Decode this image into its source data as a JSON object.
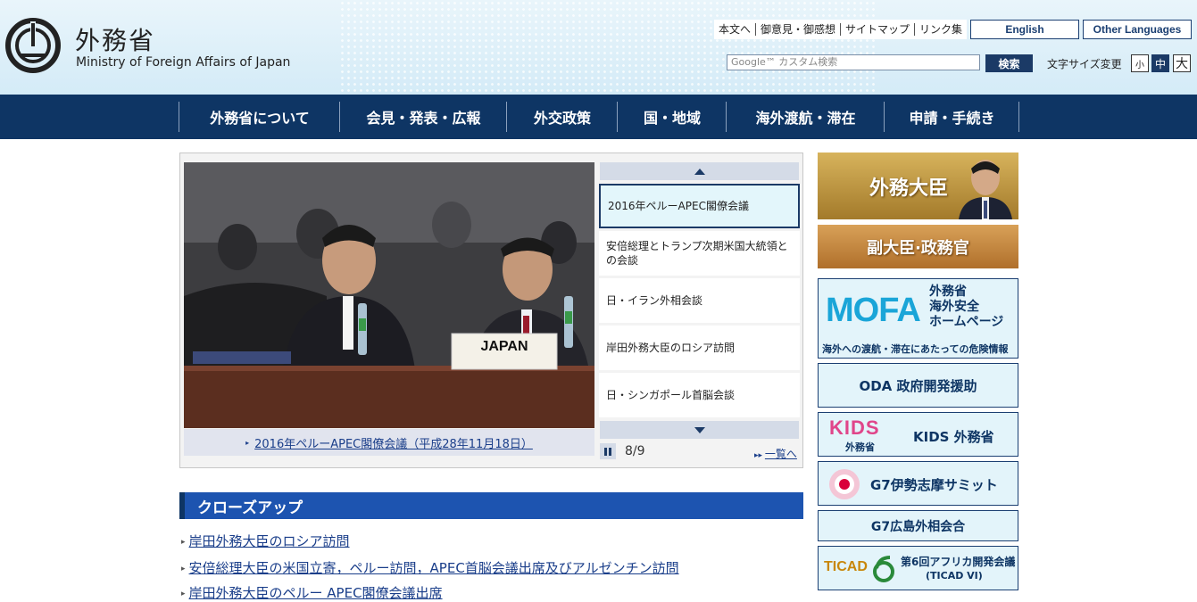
{
  "header": {
    "site_title_ja": "外務省",
    "site_title_en": "Ministry of Foreign Affairs of Japan",
    "util_links": [
      "本文へ",
      "御意見・御感想",
      "サイトマップ",
      "リンク集"
    ],
    "english_label": "English",
    "other_languages_label": "Other Languages",
    "search_placeholder": "Google™ カスタム検索",
    "search_button": "検索",
    "font_size_label": "文字サイズ変更",
    "font_sizes": [
      "小",
      "中",
      "大"
    ]
  },
  "nav": {
    "items": [
      "外務省について",
      "会見・発表・広報",
      "外交政策",
      "国・地域",
      "海外渡航・滞在",
      "申請・手続き"
    ]
  },
  "slider": {
    "photo_sign": "JAPAN",
    "caption": "2016年ペルーAPEC閣僚会議（平成28年11月18日）",
    "items": [
      "2016年ペルーAPEC閣僚会議",
      "安倍総理とトランプ次期米国大統領との会談",
      "日・イラン外相会談",
      "岸田外務大臣のロシア訪問",
      "日・シンガポール首脳会談"
    ],
    "counter": "8/9",
    "list_link": "一覧へ"
  },
  "closeup": {
    "heading": "クローズアップ",
    "items": [
      "岸田外務大臣のロシア訪問",
      "安倍総理大臣の米国立寄，ペルー訪問，APEC首脳会議出席及びアルゼンチン訪問",
      "岸田外務大臣のペルー APEC閣僚会議出席"
    ]
  },
  "banners": {
    "minister": "外務大臣",
    "vice": "副大臣·政務官",
    "mofa_logo": "MOFA",
    "mofa_title": [
      "外務省",
      "海外安全",
      "ホームページ"
    ],
    "mofa_sub": "海外への渡航・滞在にあたっての危険情報",
    "oda": "ODA 政府開発援助",
    "kids_logo": "KIDS",
    "kids_logo_sub": "外務省",
    "kids_text": "KIDS 外務省",
    "g7": "G7伊勢志摩サミット",
    "hiroshima": "G7広島外相会合",
    "ticad_logo": "TICAD",
    "ticad_text": "第6回アフリカ開発会議",
    "ticad_sub": "(TICAD VI)"
  },
  "colors": {
    "navy": "#0e3564",
    "closeup_blue": "#1d54b0",
    "link": "#1a3e8a",
    "banner_light": "#e3f4fa",
    "mofa_cyan": "#1aa5d8"
  }
}
